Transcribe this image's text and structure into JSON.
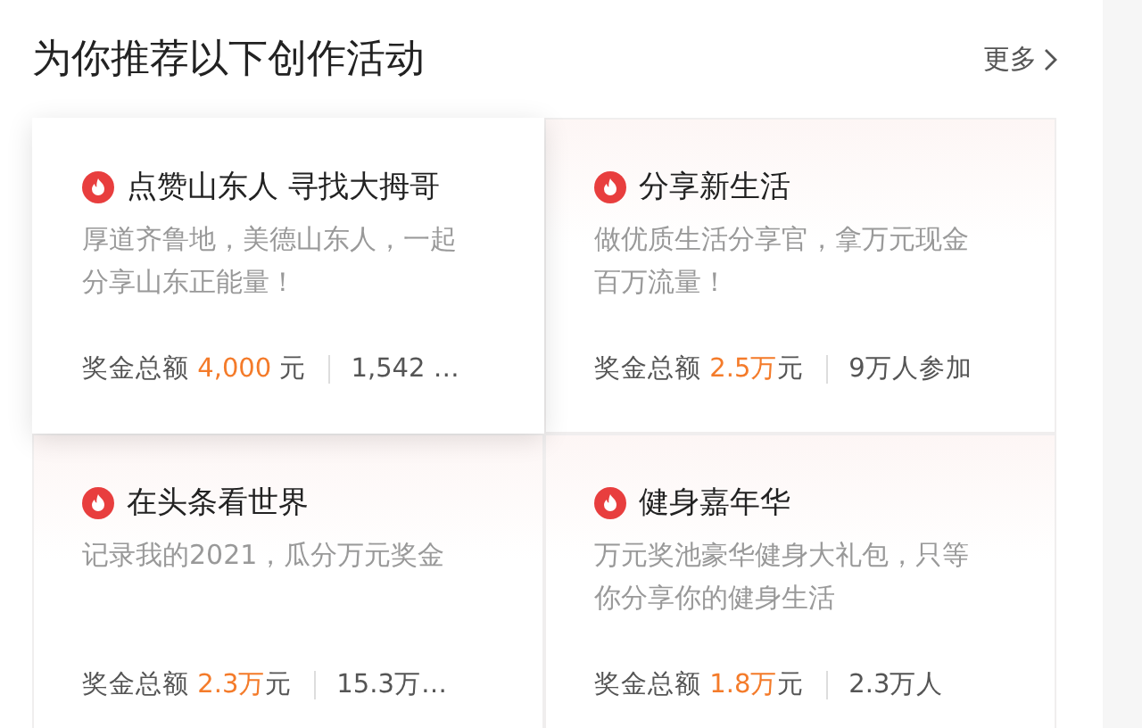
{
  "header": {
    "title": "为你推荐以下创作活动",
    "more_link": "更多"
  },
  "activities": [
    {
      "title": "点赞山东人 寻找大拇哥",
      "description": "厚道齐鲁地，美德山东人，一起分享山东正能量！",
      "prize_label": "奖金总额",
      "prize_amount": "4,000",
      "prize_unit": " 元",
      "participants": "1,542 …",
      "raised": true
    },
    {
      "title": "分享新生活",
      "description": "做优质生活分享官，拿万元现金百万流量！",
      "prize_label": "奖金总额",
      "prize_amount": "2.5万",
      "prize_unit": "元",
      "participants": "9万人参加",
      "raised": false
    },
    {
      "title": "在头条看世界",
      "description": "记录我的2021，瓜分万元奖金",
      "prize_label": "奖金总额",
      "prize_amount": "2.3万",
      "prize_unit": "元",
      "participants": "15.3万…",
      "raised": false
    },
    {
      "title": "健身嘉年华",
      "description": "万元奖池豪华健身大礼包，只等你分享你的健身生活",
      "prize_label": "奖金总额",
      "prize_amount": "1.8万",
      "prize_unit": "元",
      "participants": "2.3万人",
      "raised": false
    }
  ]
}
